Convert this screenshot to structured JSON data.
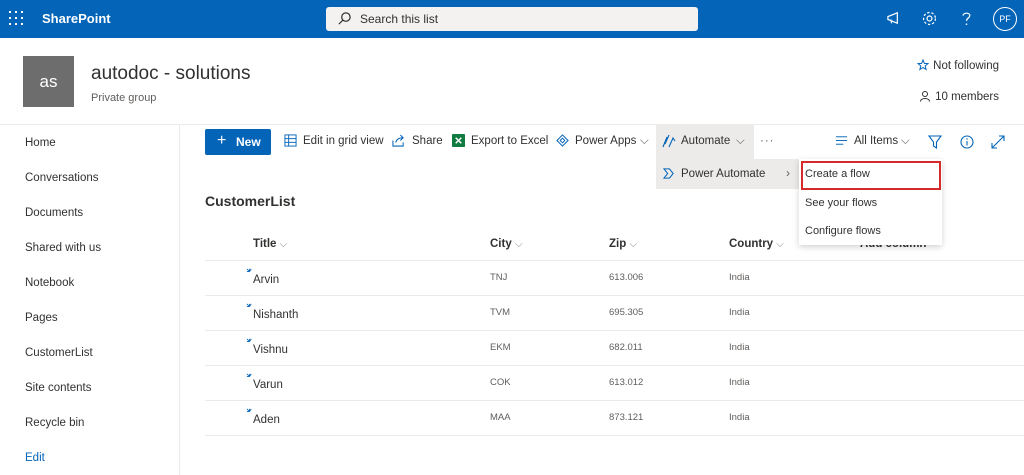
{
  "topbar": {
    "brand": "SharePoint",
    "search_placeholder": "Search this list",
    "avatar_initials": "PF",
    "icons": [
      "waffle-icon",
      "search-icon",
      "megaphone-icon",
      "gear-icon",
      "help-icon"
    ]
  },
  "site": {
    "logo_initials": "as",
    "title": "autodoc - solutions",
    "subtitle": "Private group",
    "follow_label": "Not following",
    "members_label": "10 members"
  },
  "nav": {
    "items": [
      "Home",
      "Conversations",
      "Documents",
      "Shared with us",
      "Notebook",
      "Pages",
      "CustomerList",
      "Site contents",
      "Recycle bin"
    ],
    "edit_label": "Edit"
  },
  "commands": {
    "new_label": "New",
    "grid_label": "Edit in grid view",
    "share_label": "Share",
    "export_label": "Export to Excel",
    "powerapps_label": "Power Apps",
    "automate_label": "Automate",
    "more_label": "···",
    "view_label": "All Items"
  },
  "automate_menu": {
    "item_label": "Power Automate",
    "submenu": [
      "Create a flow",
      "See your flows",
      "Configure flows"
    ]
  },
  "list": {
    "title": "CustomerList",
    "columns": [
      "Title",
      "City",
      "Zip",
      "Country"
    ],
    "add_column_label": "Add column",
    "rows": [
      {
        "title": "Arvin",
        "city": "TNJ",
        "zip": "613.006",
        "country": "India"
      },
      {
        "title": "Nishanth",
        "city": "TVM",
        "zip": "695.305",
        "country": "India"
      },
      {
        "title": "Vishnu",
        "city": "EKM",
        "zip": "682.011",
        "country": "India"
      },
      {
        "title": "Varun",
        "city": "COK",
        "zip": "613.012",
        "country": "India"
      },
      {
        "title": "Aden",
        "city": "MAA",
        "zip": "873.121",
        "country": "India"
      }
    ]
  },
  "colors": {
    "suite_bar": "#0364b8",
    "highlight": "#d32a2a",
    "logo_bg": "#6d6d6d"
  }
}
